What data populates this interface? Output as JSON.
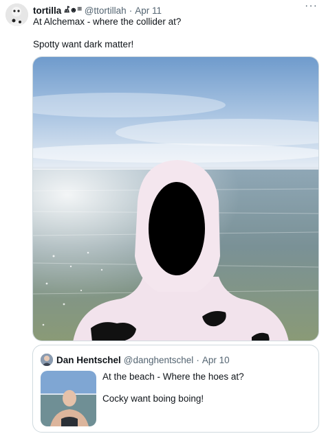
{
  "tweet": {
    "author": {
      "display_name": "tortilla",
      "name_emoji": "Ⰼ☻ᴵᴵᴵ",
      "handle": "@ttortillah",
      "separator": "·",
      "date": "Apr 11"
    },
    "more_label": "···",
    "text_line1": "At Alchemax - where the collider at?",
    "text_line2": "Spotty want dark matter!",
    "quoted": {
      "display_name": "Dan Hentschel",
      "handle": "@danghentschel",
      "separator": "·",
      "date": "Apr 10",
      "text_line1": "At the beach - Where the hoes at?",
      "text_line2": "Cocky want boing boing!"
    }
  },
  "colors": {
    "text_primary": "#0f1419",
    "text_secondary": "#536471",
    "border": "#cfd9de",
    "sky": "#8fb4dc",
    "sea": "#7e97a0"
  },
  "icons": {
    "more": "more-dots-icon"
  }
}
